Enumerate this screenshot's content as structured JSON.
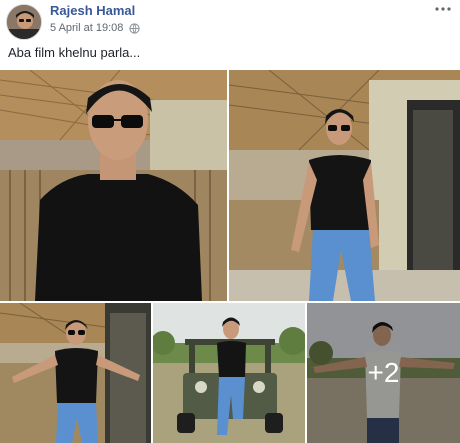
{
  "post": {
    "author": "Rajesh Hamal",
    "date": "5 April at 19:08",
    "privacy_icon": "globe-icon",
    "more_icon": "more-options-icon",
    "caption": "Aba film khelnu parla..."
  },
  "photos": {
    "items": [
      {
        "label": "photo-1",
        "scene": "man in sunglasses, black t-shirt, thatched porch"
      },
      {
        "label": "photo-2",
        "scene": "man standing by doorway, black t-shirt, blue jeans"
      },
      {
        "label": "photo-3",
        "scene": "man with arms spread on porch"
      },
      {
        "label": "photo-4",
        "scene": "man sitting on front of green jeep"
      },
      {
        "label": "photo-5",
        "scene": "man in white vest, arms outstretched, field"
      }
    ],
    "more_count": "+2"
  },
  "colors": {
    "author_link": "#385898",
    "meta_text": "#616770",
    "body_text": "#1d2129"
  }
}
